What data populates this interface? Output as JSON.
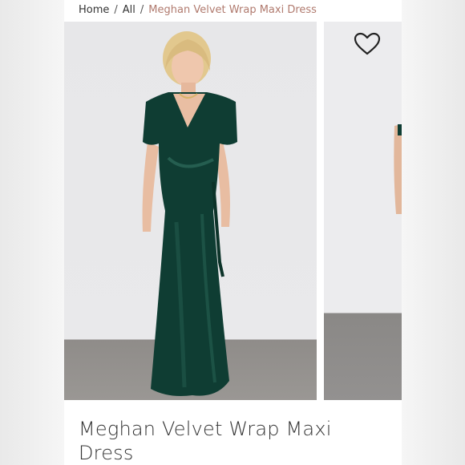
{
  "breadcrumb": {
    "items": [
      {
        "label": "Home"
      },
      {
        "label": "All"
      }
    ],
    "separator": "/",
    "current": "Meghan Velvet Wrap Maxi Dress"
  },
  "product": {
    "title": "Meghan Velvet Wrap Maxi Dress",
    "dress_color": "#0f3d33"
  },
  "icons": {
    "wishlist": "heart-icon"
  },
  "colors": {
    "breadcrumb_active": "#b07a6e",
    "text": "#333333"
  }
}
